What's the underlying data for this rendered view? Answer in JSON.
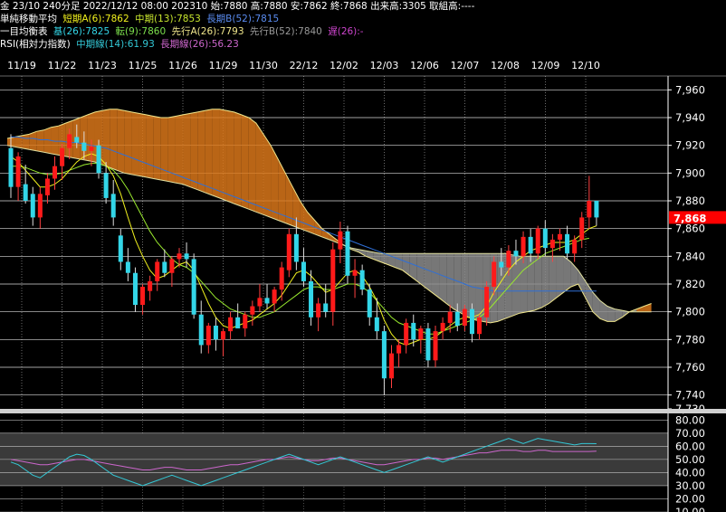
{
  "header": {
    "line1": "金 23/10 240分足 2022/12/12 08:00 202310 始:7880 高:7880 安:7862 終:7868 出来高:3305 取組高:----",
    "sma_label": "単純移動平均",
    "sma_a": "短期A(6):7862",
    "sma_b": "中期(13):7853",
    "sma_c": "長期B(52):7815",
    "ich_label": "一目均衡表",
    "ich_kijun": "基(26):7825",
    "ich_tenkan": "転(9):7860",
    "ich_spanA": "先行A(26):7793",
    "ich_spanB": "先行B(52):7840",
    "ich_chikou": "遅(26):-",
    "rsi_label": "RSI(相対力指数)",
    "rsi_mid": "中期線(14):61.93",
    "rsi_long": "長期線(26):56.23"
  },
  "colors": {
    "bg": "#000000",
    "up": "#ff1a1a",
    "down": "#33d6e8",
    "sma_short": "#f2f21e",
    "sma_mid": "#9aea2e",
    "sma_long": "#2f6fd6",
    "kijun": "#33d6e8",
    "tenkan": "#7ce04c",
    "span_a": "#f0e68c",
    "span_b": "#e0e0a0",
    "chikou": "#cc44cc",
    "cloud": "#8c8c8c",
    "cloud_bull": "#d9771a",
    "rsi_mid": "#33c8d6",
    "rsi_long": "#cc66cc",
    "current_price_bg": "#ff0000",
    "grid": "#ffffff",
    "gray_label": "#999999"
  },
  "chart_data": {
    "type": "candlestick",
    "dates": [
      "11/19",
      "11/22",
      "11/23",
      "11/25",
      "11/26",
      "11/29",
      "11/30",
      "22/12",
      "12/02",
      "12/03",
      "12/06",
      "12/07",
      "12/08",
      "12/09",
      "12/10"
    ],
    "price_axis": {
      "ylim": [
        7730,
        7970
      ],
      "ticks": [
        "7,960",
        "7,940",
        "7,920",
        "7,900",
        "7,880",
        "7,860",
        "7,840",
        "7,820",
        "7,800",
        "7,780",
        "7,760",
        "7,740",
        "7,730"
      ],
      "current_price_label": "7,868",
      "current_price": 7868
    },
    "rsi_axis": {
      "ylim": [
        10,
        85
      ],
      "ticks": [
        "80.00",
        "70.00",
        "60.00",
        "50.00",
        "40.00",
        "30.00",
        "20.00",
        "10.00"
      ],
      "band": [
        30,
        70
      ]
    },
    "candles": [
      [
        7918,
        7928,
        7882,
        7890
      ],
      [
        7890,
        7915,
        7880,
        7912
      ],
      [
        7892,
        7906,
        7878,
        7880
      ],
      [
        7885,
        7890,
        7862,
        7868
      ],
      [
        7868,
        7890,
        7860,
        7885
      ],
      [
        7884,
        7900,
        7878,
        7896
      ],
      [
        7896,
        7912,
        7888,
        7905
      ],
      [
        7905,
        7921,
        7895,
        7918
      ],
      [
        7918,
        7932,
        7910,
        7928
      ],
      [
        7926,
        7935,
        7918,
        7922
      ],
      [
        7922,
        7930,
        7910,
        7916
      ],
      [
        7916,
        7924,
        7905,
        7919
      ],
      [
        7920,
        7924,
        7896,
        7900
      ],
      [
        7900,
        7908,
        7878,
        7882
      ],
      [
        7885,
        7895,
        7862,
        7868
      ],
      [
        7855,
        7860,
        7830,
        7836
      ],
      [
        7836,
        7846,
        7822,
        7828
      ],
      [
        7828,
        7832,
        7800,
        7805
      ],
      [
        7805,
        7820,
        7798,
        7818
      ],
      [
        7815,
        7826,
        7808,
        7822
      ],
      [
        7822,
        7838,
        7815,
        7836
      ],
      [
        7836,
        7845,
        7825,
        7828
      ],
      [
        7828,
        7840,
        7818,
        7838
      ],
      [
        7838,
        7846,
        7832,
        7842
      ],
      [
        7842,
        7850,
        7832,
        7838
      ],
      [
        7838,
        7842,
        7795,
        7798
      ],
      [
        7798,
        7808,
        7770,
        7776
      ],
      [
        7776,
        7792,
        7770,
        7790
      ],
      [
        7790,
        7796,
        7772,
        7780
      ],
      [
        7780,
        7788,
        7768,
        7786
      ],
      [
        7786,
        7800,
        7780,
        7796
      ],
      [
        7796,
        7806,
        7790,
        7788
      ],
      [
        7788,
        7800,
        7782,
        7798
      ],
      [
        7798,
        7808,
        7790,
        7804
      ],
      [
        7804,
        7820,
        7800,
        7810
      ],
      [
        7810,
        7820,
        7802,
        7806
      ],
      [
        7806,
        7818,
        7800,
        7816
      ],
      [
        7816,
        7836,
        7808,
        7832
      ],
      [
        7830,
        7860,
        7825,
        7856
      ],
      [
        7856,
        7868,
        7830,
        7836
      ],
      [
        7836,
        7846,
        7818,
        7822
      ],
      [
        7822,
        7830,
        7790,
        7796
      ],
      [
        7796,
        7810,
        7786,
        7806
      ],
      [
        7806,
        7820,
        7796,
        7800
      ],
      [
        7800,
        7850,
        7790,
        7845
      ],
      [
        7845,
        7865,
        7835,
        7858
      ],
      [
        7858,
        7862,
        7820,
        7826
      ],
      [
        7826,
        7838,
        7810,
        7830
      ],
      [
        7830,
        7834,
        7812,
        7816
      ],
      [
        7816,
        7820,
        7790,
        7796
      ],
      [
        7796,
        7810,
        7780,
        7786
      ],
      [
        7786,
        7790,
        7740,
        7752
      ],
      [
        7752,
        7776,
        7745,
        7770
      ],
      [
        7770,
        7780,
        7760,
        7776
      ],
      [
        7776,
        7795,
        7770,
        7792
      ],
      [
        7792,
        7798,
        7775,
        7780
      ],
      [
        7780,
        7790,
        7770,
        7788
      ],
      [
        7788,
        7792,
        7760,
        7765
      ],
      [
        7765,
        7790,
        7760,
        7786
      ],
      [
        7786,
        7796,
        7780,
        7792
      ],
      [
        7792,
        7805,
        7785,
        7800
      ],
      [
        7800,
        7806,
        7786,
        7790
      ],
      [
        7790,
        7805,
        7786,
        7802
      ],
      [
        7802,
        7806,
        7778,
        7784
      ],
      [
        7784,
        7798,
        7780,
        7796
      ],
      [
        7796,
        7822,
        7790,
        7818
      ],
      [
        7818,
        7840,
        7812,
        7836
      ],
      [
        7836,
        7846,
        7826,
        7832
      ],
      [
        7832,
        7848,
        7826,
        7844
      ],
      [
        7844,
        7852,
        7834,
        7840
      ],
      [
        7840,
        7858,
        7835,
        7854
      ],
      [
        7854,
        7860,
        7836,
        7842
      ],
      [
        7842,
        7862,
        7838,
        7860
      ],
      [
        7860,
        7866,
        7840,
        7846
      ],
      [
        7846,
        7856,
        7836,
        7852
      ],
      [
        7852,
        7860,
        7844,
        7856
      ],
      [
        7856,
        7862,
        7838,
        7842
      ],
      [
        7842,
        7855,
        7836,
        7852
      ],
      [
        7852,
        7872,
        7846,
        7868
      ],
      [
        7868,
        7898,
        7860,
        7880
      ],
      [
        7880,
        7880,
        7862,
        7868
      ]
    ],
    "ichimoku_cloud": {
      "span_a": [
        7925,
        7926,
        7927,
        7928,
        7930,
        7931,
        7933,
        7934,
        7936,
        7938,
        7940,
        7942,
        7944,
        7945,
        7946,
        7946,
        7945,
        7944,
        7943,
        7942,
        7941,
        7940,
        7940,
        7941,
        7942,
        7943,
        7944,
        7945,
        7946,
        7946,
        7945,
        7944,
        7942,
        7940,
        7936,
        7928,
        7920,
        7910,
        7900,
        7890,
        7880,
        7872,
        7866,
        7860,
        7856,
        7852,
        7848,
        7845,
        7843,
        7840,
        7838,
        7836,
        7834,
        7832,
        7830,
        7826,
        7822,
        7818,
        7814,
        7810,
        7806,
        7802,
        7799,
        7796,
        7794,
        7793,
        7792,
        7793,
        7795,
        7797,
        7799,
        7800,
        7801,
        7803,
        7806,
        7810,
        7814,
        7818,
        7820,
        7810,
        7800,
        7795,
        7793,
        7793,
        7796,
        7800,
        7802,
        7804,
        7806
      ],
      "span_b": [
        7920,
        7919,
        7918,
        7917,
        7916,
        7915,
        7914,
        7913,
        7912,
        7911,
        7910,
        7909,
        7908,
        7906,
        7904,
        7902,
        7900,
        7899,
        7898,
        7897,
        7896,
        7895,
        7894,
        7893,
        7892,
        7890,
        7888,
        7886,
        7884,
        7882,
        7880,
        7878,
        7876,
        7874,
        7872,
        7870,
        7868,
        7866,
        7864,
        7862,
        7860,
        7858,
        7856,
        7854,
        7852,
        7850,
        7848,
        7846,
        7845,
        7844,
        7843,
        7842,
        7842,
        7842,
        7842,
        7842,
        7842,
        7842,
        7842,
        7842,
        7842,
        7842,
        7842,
        7842,
        7842,
        7842,
        7842,
        7842,
        7842,
        7841,
        7840,
        7840,
        7840,
        7840,
        7840,
        7840,
        7840,
        7836,
        7830,
        7822,
        7814,
        7808,
        7804,
        7802,
        7801,
        7800,
        7800,
        7800,
        7800
      ]
    },
    "sma_short": [
      7912,
      7908,
      7902,
      7896,
      7890,
      7890,
      7892,
      7896,
      7902,
      7908,
      7912,
      7914,
      7912,
      7906,
      7898,
      7885,
      7868,
      7852,
      7840,
      7830,
      7824,
      7826,
      7830,
      7834,
      7836,
      7830,
      7818,
      7806,
      7796,
      7790,
      7788,
      7790,
      7792,
      7794,
      7798,
      7802,
      7806,
      7812,
      7820,
      7828,
      7830,
      7826,
      7820,
      7814,
      7816,
      7822,
      7828,
      7830,
      7826,
      7818,
      7808,
      7794,
      7784,
      7778,
      7776,
      7778,
      7780,
      7780,
      7782,
      7786,
      7790,
      7794,
      7796,
      7796,
      7798,
      7804,
      7814,
      7822,
      7830,
      7836,
      7840,
      7844,
      7846,
      7848,
      7850,
      7850,
      7850,
      7852,
      7856,
      7860,
      7862
    ],
    "sma_mid": [
      7905,
      7905,
      7904,
      7902,
      7900,
      7899,
      7899,
      7900,
      7902,
      7904,
      7906,
      7907,
      7907,
      7905,
      7902,
      7896,
      7888,
      7878,
      7868,
      7858,
      7850,
      7844,
      7838,
      7834,
      7832,
      7828,
      7822,
      7816,
      7810,
      7806,
      7802,
      7800,
      7798,
      7796,
      7796,
      7798,
      7800,
      7804,
      7808,
      7812,
      7816,
      7818,
      7818,
      7816,
      7816,
      7818,
      7820,
      7820,
      7818,
      7814,
      7808,
      7802,
      7796,
      7792,
      7790,
      7788,
      7786,
      7784,
      7784,
      7786,
      7788,
      7790,
      7792,
      7794,
      7796,
      7800,
      7806,
      7812,
      7818,
      7824,
      7830,
      7834,
      7838,
      7842,
      7844,
      7846,
      7848,
      7850,
      7852,
      7853
    ],
    "sma_long": [
      7926,
      7926,
      7925,
      7925,
      7924,
      7924,
      7923,
      7923,
      7922,
      7922,
      7921,
      7920,
      7919,
      7918,
      7916,
      7914,
      7912,
      7910,
      7908,
      7906,
      7904,
      7902,
      7900,
      7898,
      7896,
      7894,
      7892,
      7890,
      7888,
      7886,
      7884,
      7882,
      7880,
      7878,
      7876,
      7874,
      7872,
      7870,
      7868,
      7866,
      7864,
      7862,
      7860,
      7858,
      7856,
      7854,
      7852,
      7850,
      7848,
      7846,
      7844,
      7842,
      7840,
      7838,
      7836,
      7834,
      7832,
      7830,
      7828,
      7826,
      7824,
      7822,
      7820,
      7818,
      7817,
      7816,
      7815,
      7815,
      7815,
      7815,
      7815,
      7815,
      7815,
      7815,
      7815,
      7815,
      7815,
      7815,
      7815,
      7815,
      7815
    ],
    "rsi_mid": [
      48,
      46,
      42,
      38,
      36,
      40,
      44,
      48,
      52,
      54,
      53,
      50,
      46,
      42,
      38,
      36,
      34,
      32,
      30,
      32,
      34,
      36,
      38,
      36,
      34,
      32,
      30,
      32,
      34,
      36,
      38,
      40,
      42,
      44,
      46,
      48,
      50,
      52,
      54,
      52,
      50,
      48,
      46,
      48,
      50,
      52,
      50,
      48,
      46,
      44,
      42,
      40,
      42,
      44,
      46,
      48,
      50,
      52,
      50,
      48,
      50,
      52,
      54,
      56,
      58,
      60,
      62,
      64,
      66,
      64,
      62,
      64,
      66,
      65,
      64,
      63,
      62,
      61,
      62,
      62,
      61.93
    ],
    "rsi_long": [
      50,
      49,
      48,
      47,
      46,
      46,
      47,
      48,
      49,
      50,
      50,
      49,
      48,
      47,
      46,
      45,
      44,
      43,
      42,
      42,
      43,
      44,
      44,
      43,
      42,
      42,
      42,
      43,
      44,
      45,
      46,
      46,
      47,
      48,
      49,
      50,
      50,
      51,
      52,
      51,
      50,
      49,
      49,
      50,
      51,
      51,
      50,
      49,
      48,
      47,
      46,
      46,
      47,
      48,
      49,
      50,
      50,
      51,
      51,
      50,
      51,
      52,
      53,
      54,
      55,
      55,
      56,
      57,
      57,
      57,
      56,
      56,
      57,
      57,
      56,
      56,
      56,
      56,
      56,
      56,
      56.23
    ]
  }
}
